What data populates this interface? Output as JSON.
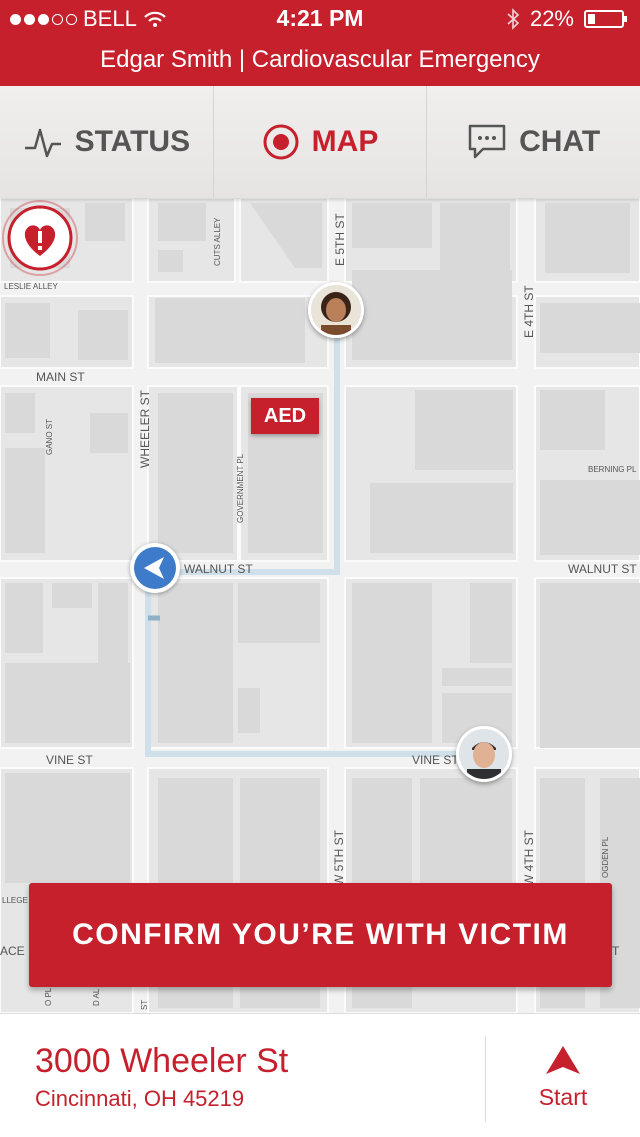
{
  "status_bar": {
    "carrier": "BELL",
    "time": "4:21 PM",
    "battery": "22%",
    "battery_level": 0.22
  },
  "header": {
    "subtitle": "Edgar Smith | Cardiovascular Emergency"
  },
  "tabs": [
    {
      "label": "STATUS",
      "icon": "pulse-icon"
    },
    {
      "label": "MAP",
      "icon": "target-icon",
      "active": true
    },
    {
      "label": "CHAT",
      "icon": "chat-bubble-icon"
    }
  ],
  "map": {
    "streets": {
      "e5th_top": "E 5TH ST",
      "cuts_alley": "CUTS ALLEY",
      "leslie_alley": "LESLIE ALLEY",
      "e4th": "E 4TH ST",
      "main": "MAIN ST",
      "gano": "GANO ST",
      "wheeler": "WHEELER ST",
      "government": "GOVERNMENT PL",
      "berning": "BERNING PL",
      "walnut1": "WALNUT ST",
      "walnut2": "WALNUT ST",
      "vine1": "VINE ST",
      "vine2": "VINE ST",
      "w5th": "W 5TH ST",
      "w4th": "W 4TH ST",
      "ogden": "OGDEN PL",
      "college": "LLEGE ST",
      "ace": "ACE",
      "o_pl": "O PL",
      "d_al": "D AL",
      "st": "ST",
      "t": "T"
    },
    "aed_label": "AED",
    "markers": [
      "responder-avatar-woman",
      "responder-avatar-man",
      "navigation-arrow-icon",
      "victim-heart-icon"
    ]
  },
  "confirm_button": "CONFIRM YOU’RE WITH VICTIM",
  "address": {
    "street": "3000 Wheeler St",
    "city": "Cincinnati, OH 45219"
  },
  "start_button": "Start",
  "colors": {
    "brand_red": "#c5202c",
    "nav_blue": "#3e7bc8",
    "route": "#cfe0ea"
  }
}
